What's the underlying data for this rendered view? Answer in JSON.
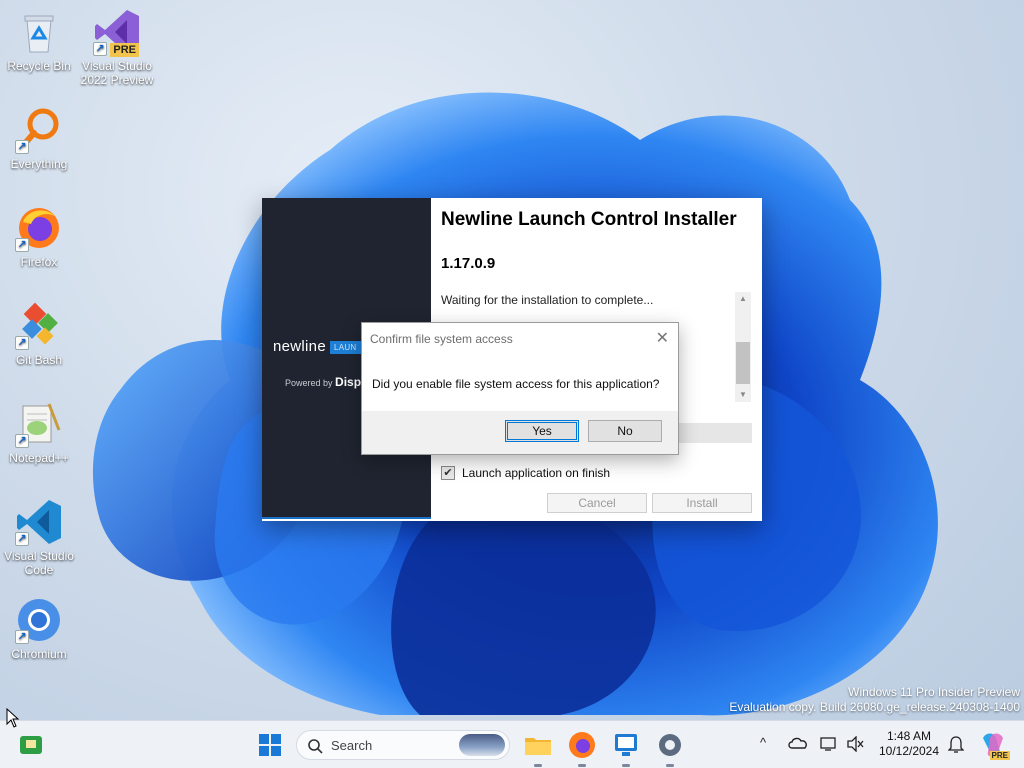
{
  "desktop": {
    "icons": [
      {
        "label": "Recycle Bin",
        "icon": "recycle-bin-icon"
      },
      {
        "label": "Visual Studio 2022 Preview",
        "icon": "visual-studio-preview-icon",
        "badge": "PRE"
      },
      {
        "label": "Everything",
        "icon": "everything-search-icon"
      },
      {
        "label": "Firefox",
        "icon": "firefox-icon"
      },
      {
        "label": "Git Bash",
        "icon": "git-bash-icon"
      },
      {
        "label": "Notepad++",
        "icon": "notepad-plus-plus-icon"
      },
      {
        "label": "Visual Studio Code",
        "icon": "vscode-icon"
      },
      {
        "label": "Chromium",
        "icon": "chromium-icon"
      }
    ],
    "shortcut_arrow": "↗"
  },
  "installer": {
    "title": "Newline Launch Control Installer",
    "version": "1.17.0.9",
    "status": "Waiting for the installation to complete...",
    "progress": 0.2,
    "brand": "newline",
    "brand_tag": "LAUN",
    "powered_by": "Powered by",
    "powered_brand": "Disp",
    "launch_on_finish_label": "Launch application on finish",
    "launch_on_finish": true,
    "cancel_label": "Cancel",
    "install_label": "Install",
    "accent": "#5aab46"
  },
  "dialog": {
    "title": "Confirm file system access",
    "close": "✕",
    "message": "Did you enable file system access for this application?",
    "yes_label": "Yes",
    "no_label": "No"
  },
  "watermark": {
    "line1": "Windows 11 Pro Insider Preview",
    "line2": "Evaluation copy. Build 26080.ge_release.240308-1400"
  },
  "taskbar": {
    "search_placeholder": "Search",
    "apps": [
      "start-icon",
      "file-explorer-icon",
      "firefox-icon",
      "remote-desktop-icon",
      "settings-icon"
    ],
    "tray": {
      "chevron": "^",
      "time": "1:48 AM",
      "date": "10/12/2024",
      "copilot_badge": "PRE"
    }
  }
}
